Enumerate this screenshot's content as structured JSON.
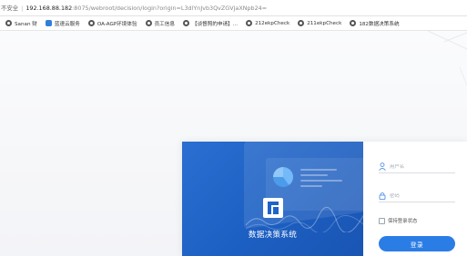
{
  "browser": {
    "security_label": "不安全",
    "url_host": "192.168.88.182",
    "url_path": ":8075/webroot/decision/login?origin=L3dlYnJvb3QvZGVjaXNpb24="
  },
  "bookmarks": [
    {
      "label": "Sanan 财",
      "icon": "globe-icon"
    },
    {
      "label": "蓝速云服务",
      "icon": "cloud-icon"
    },
    {
      "label": "OA-AGP环境体验",
      "icon": "globe-icon"
    },
    {
      "label": "员工信息",
      "icon": "globe-icon"
    },
    {
      "label": "【谈督照的申请】...",
      "icon": "globe-icon"
    },
    {
      "label": "212ekpCheck",
      "icon": "globe-icon"
    },
    {
      "label": "211ekpCheck",
      "icon": "globe-icon"
    },
    {
      "label": "182数据决策系统",
      "icon": "globe-icon"
    }
  ],
  "login": {
    "brand_title": "数据决策系统",
    "username_placeholder": "用户名",
    "password_placeholder": "密码",
    "remember_label": "保持登录状态",
    "login_button": "登录"
  },
  "colors": {
    "brand_blue": "#1c5fc2",
    "button_blue": "#2b7de6"
  }
}
